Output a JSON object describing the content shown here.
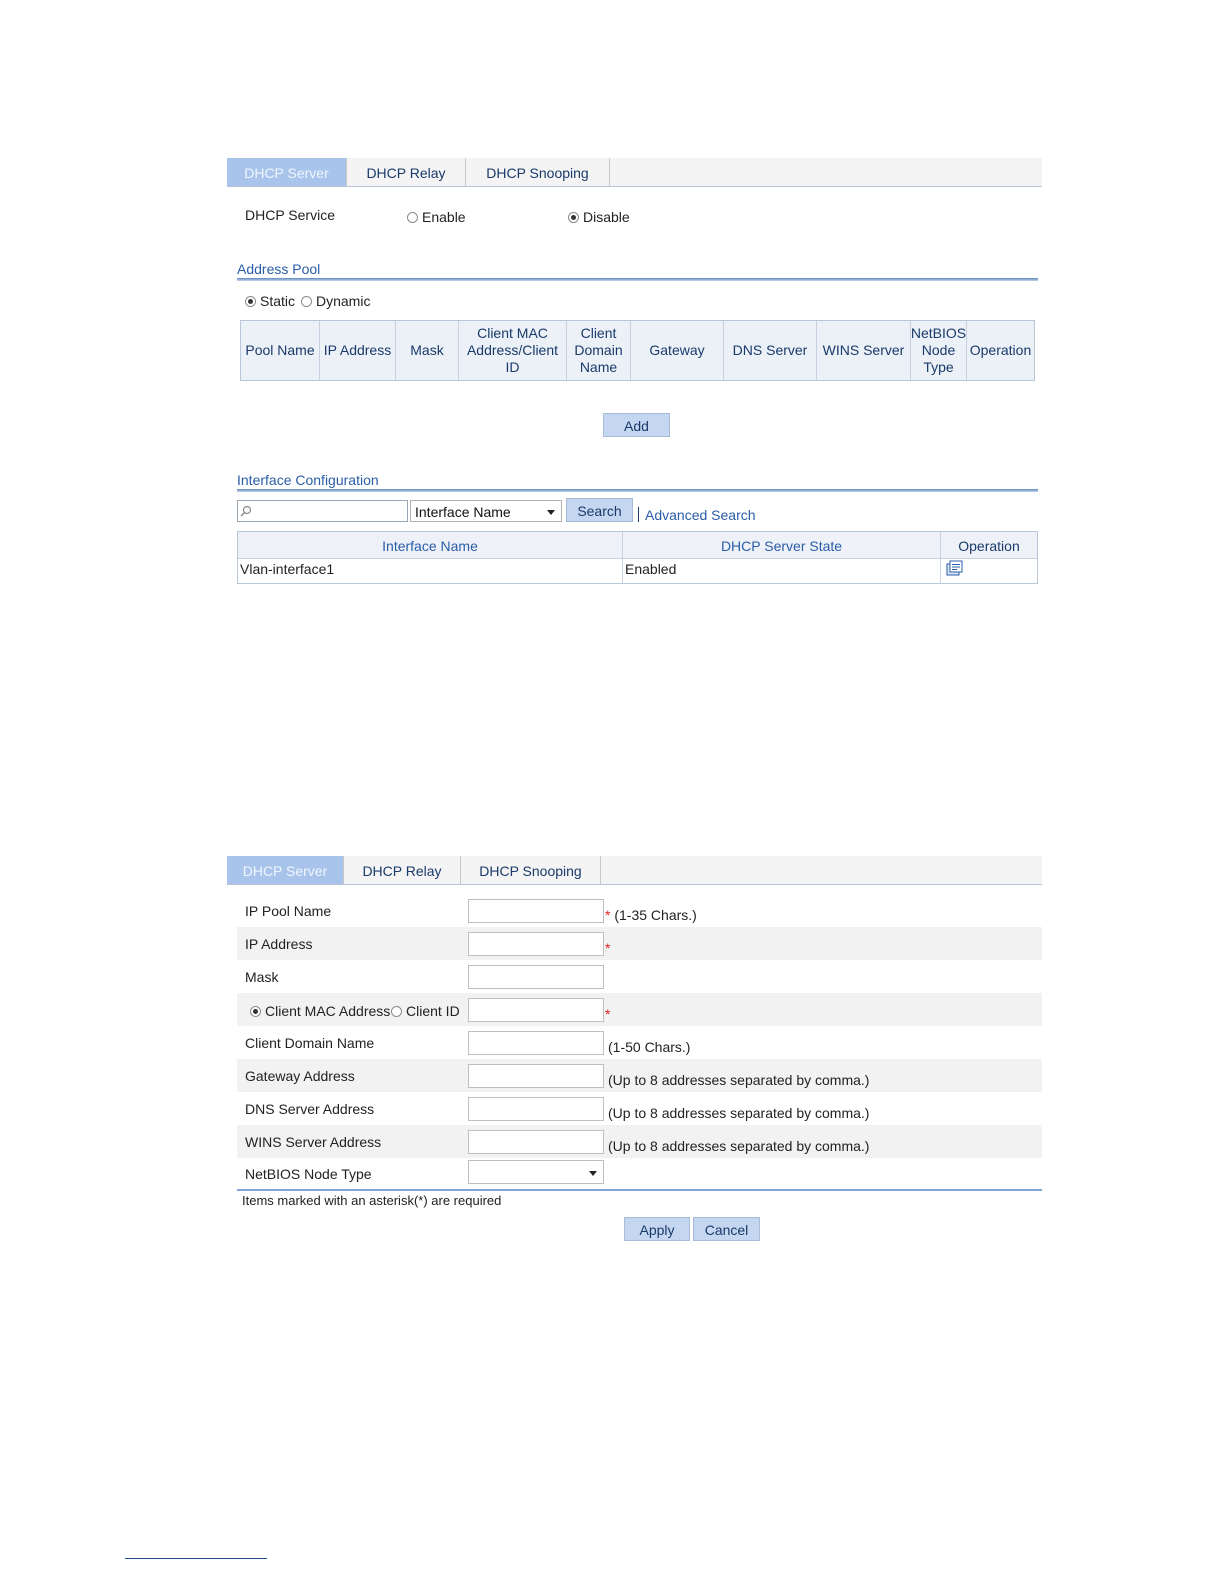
{
  "screen1": {
    "tabs": [
      {
        "label": "DHCP Server",
        "active": true
      },
      {
        "label": "DHCP Relay",
        "active": false
      },
      {
        "label": "DHCP Snooping",
        "active": false
      }
    ],
    "dhcp_service": {
      "label": "DHCP Service",
      "enable_label": "Enable",
      "disable_label": "Disable",
      "selected": "Disable"
    },
    "address_pool": {
      "title": "Address Pool",
      "static_label": "Static",
      "dynamic_label": "Dynamic",
      "selected": "Static",
      "columns": [
        "Pool Name",
        "IP Address",
        "Mask",
        "Client MAC Address/Client ID",
        "Client Domain Name",
        "Gateway",
        "DNS Server",
        "WINS Server",
        "NetBIOS Node Type",
        "Operation"
      ],
      "add_label": "Add"
    },
    "interface_config": {
      "title": "Interface Configuration",
      "search_value": "",
      "search_field": "Interface Name",
      "search_label": "Search",
      "advanced_search_label": "Advanced Search",
      "columns": [
        "Interface Name",
        "DHCP Server State",
        "Operation"
      ],
      "rows": [
        {
          "interface": "Vlan-interface1",
          "state": "Enabled",
          "operation_icon": "edit-icon"
        }
      ]
    }
  },
  "screen2": {
    "tabs": [
      {
        "label": "DHCP Server",
        "active": true
      },
      {
        "label": "DHCP Relay",
        "active": false
      },
      {
        "label": "DHCP Snooping",
        "active": false
      }
    ],
    "form": {
      "ip_pool_name": {
        "label": "IP Pool Name",
        "value": "",
        "hint": "(1-35 Chars.)",
        "required": true
      },
      "ip_address": {
        "label": "IP Address",
        "value": "",
        "hint": "",
        "required": true
      },
      "mask": {
        "label": "Mask",
        "value": "",
        "hint": "",
        "required": false
      },
      "client_id": {
        "mac_label": "Client MAC Address",
        "id_label": "Client ID",
        "selected": "Client MAC Address",
        "value": "",
        "required": true
      },
      "client_domain": {
        "label": "Client Domain Name",
        "value": "",
        "hint": "(1-50 Chars.)"
      },
      "gateway": {
        "label": "Gateway Address",
        "value": "",
        "hint": "(Up to 8 addresses separated by comma.)"
      },
      "dns": {
        "label": "DNS Server Address",
        "value": "",
        "hint": "(Up to 8 addresses separated by comma.)"
      },
      "wins": {
        "label": "WINS Server Address",
        "value": "",
        "hint": "(Up to 8 addresses separated by comma.)"
      },
      "netbios": {
        "label": "NetBIOS Node Type",
        "value": ""
      }
    },
    "required_note": "Items marked with an asterisk(*) are required",
    "apply_label": "Apply",
    "cancel_label": "Cancel"
  },
  "colors": {
    "active_tab": "#a9c4ea",
    "link": "#2a5da8",
    "button": "#c4d6f0",
    "required": "#e02020"
  }
}
